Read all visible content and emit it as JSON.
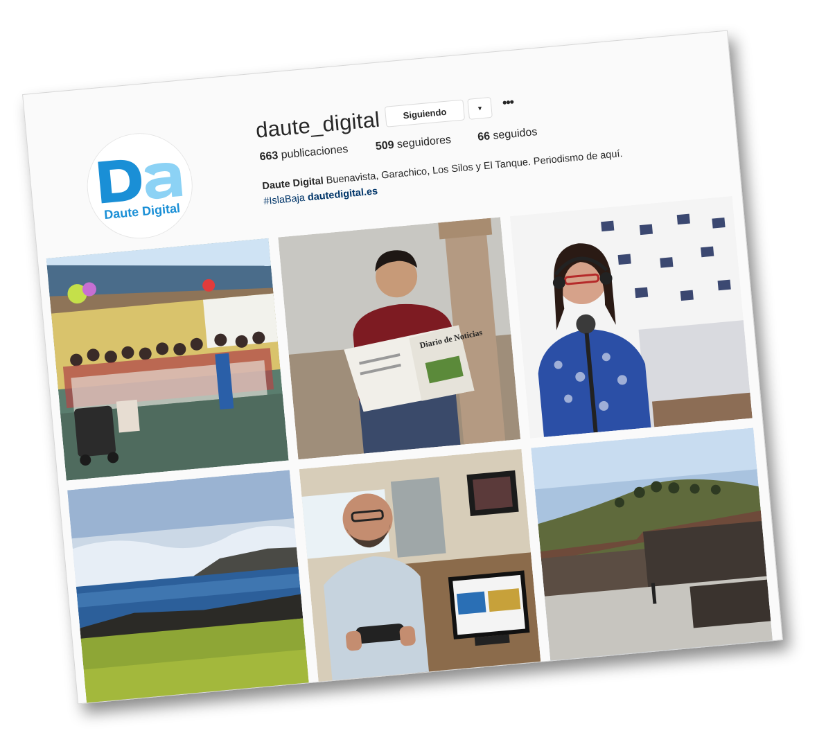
{
  "profile": {
    "username": "daute_digital",
    "follow_button": "Siguiendo",
    "dropdown_glyph": "▼",
    "more_glyph": "•••",
    "avatar_text": "Daute Digital",
    "avatar_letters": "Da"
  },
  "stats": {
    "posts_count": "663",
    "posts_label": "publicaciones",
    "followers_count": "509",
    "followers_label": "seguidores",
    "following_count": "66",
    "following_label": "seguidos"
  },
  "bio": {
    "name": "Daute Digital",
    "text": "Buenavista, Garachico, Los Silos y El Tanque. Periodismo de aquí.",
    "hashtag": "#IslaBaja",
    "link": "dautedigital.es"
  },
  "posts": [
    {
      "name": "post-outdoor-event"
    },
    {
      "name": "post-man-newspaper"
    },
    {
      "name": "post-woman-radio"
    },
    {
      "name": "post-coast-landscape"
    },
    {
      "name": "post-man-studio"
    },
    {
      "name": "post-stone-houses"
    }
  ],
  "images": {
    "newspaper_masthead": "Diario de Noticias"
  },
  "colors": {
    "brand_blue": "#1a8fd6",
    "brand_light_blue": "#8cd2f5",
    "link": "#003569"
  }
}
